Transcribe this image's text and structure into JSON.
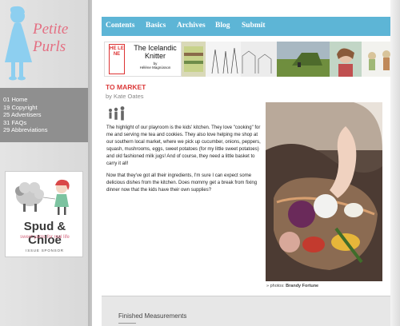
{
  "logo": {
    "line1": "Petite",
    "line2": "Purls"
  },
  "sidebar": {
    "items": [
      {
        "num": "01",
        "label": "Home"
      },
      {
        "num": "19",
        "label": "Copyright"
      },
      {
        "num": "25",
        "label": "Advertisers"
      },
      {
        "num": "31",
        "label": "FAQs"
      },
      {
        "num": "29",
        "label": "Abbreviations"
      }
    ]
  },
  "sponsor": {
    "name": "Spud & Chloë",
    "tagline": "sweet yarns for real life",
    "label": "ISSUE SPONSOR"
  },
  "nav": {
    "items": [
      "Contents",
      "Basics",
      "Archives",
      "Blog",
      "Submit"
    ]
  },
  "banner": {
    "helene": "HE LE NE",
    "title": "The Icelandic Knitter",
    "by": "by",
    "author": "Hélène Magnússon"
  },
  "article": {
    "title": "TO MARKET",
    "byline": "by Kate Oates",
    "paragraphs": [
      "The highlight of our playroom is the kids' kitchen. They love \"cooking\" for me and serving me tea and cookies. They also love helping me shop at our southern local market, where we pick up cucumber, onions, peppers, squash, mushrooms, eggs, sweet potatoes (for my little sweet potatoes) and old fashioned milk jugs! And of course, they need a little basket to carry it all!",
      "Now that they've got all their ingredients, I'm sure I can expect some delicious dishes from the kitchen. Does mommy get a break from fixing dinner now that the kids have their own supplies?"
    ],
    "photo_credit_prefix": "» photos:",
    "photo_credit": "Brandy Fortune"
  },
  "footer": {
    "heading": "Finished Measurements"
  },
  "colors": {
    "nav": "#5db5d6",
    "title_red": "#dc3a3a",
    "logo_pink": "#e46f82",
    "logo_blue": "#7ec8e8"
  }
}
